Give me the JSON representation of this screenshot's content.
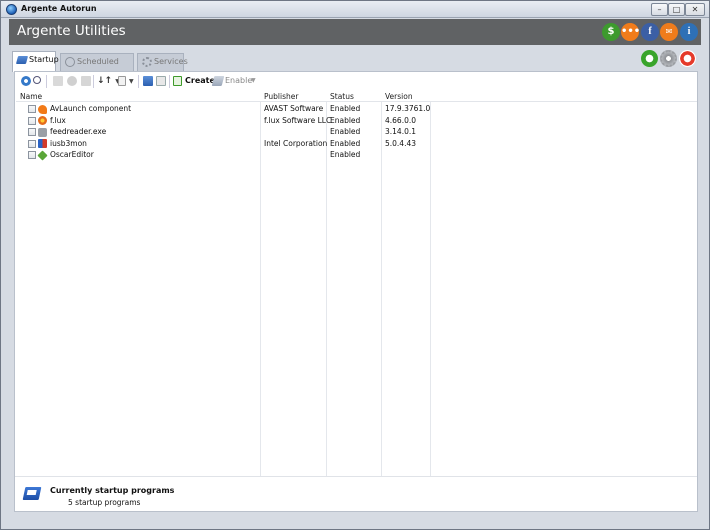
{
  "window": {
    "title": "Argente Autorun"
  },
  "header": {
    "title": "Argente Utilities"
  },
  "header_buttons": [
    {
      "name": "donate",
      "glyph": "$"
    },
    {
      "name": "feedback",
      "glyph": "•••"
    },
    {
      "name": "facebook",
      "glyph": "f"
    },
    {
      "name": "mail",
      "glyph": "✉"
    },
    {
      "name": "info",
      "glyph": "i"
    }
  ],
  "tabs": [
    {
      "label": "Startup",
      "active": true
    },
    {
      "label": "Scheduled tasks",
      "active": false
    },
    {
      "label": "Services",
      "active": false
    }
  ],
  "toolbar": {
    "create_label": "Create",
    "enable_label": "Enable"
  },
  "table": {
    "columns": [
      "Name",
      "Publisher",
      "Status",
      "Version"
    ],
    "rows": [
      {
        "name": "AvLaunch component",
        "publisher": "AVAST Software",
        "status": "Enabled",
        "version": "17.9.3761.0",
        "icon": "avast-icon"
      },
      {
        "name": "f.lux",
        "publisher": "f.lux Software LLC",
        "status": "Enabled",
        "version": "4.66.0.0",
        "icon": "flux-icon"
      },
      {
        "name": "feedreader.exe",
        "publisher": "",
        "status": "Enabled",
        "version": "3.14.0.1",
        "icon": "feedreader-icon"
      },
      {
        "name": "iusb3mon",
        "publisher": "Intel Corporation",
        "status": "Enabled",
        "version": "5.0.4.43",
        "icon": "usb-monitor-icon"
      },
      {
        "name": "OscarEditor",
        "publisher": "",
        "status": "Enabled",
        "version": "",
        "icon": "oscar-editor-icon"
      }
    ]
  },
  "footer": {
    "title": "Currently startup programs",
    "count_text": "5 startup programs"
  }
}
